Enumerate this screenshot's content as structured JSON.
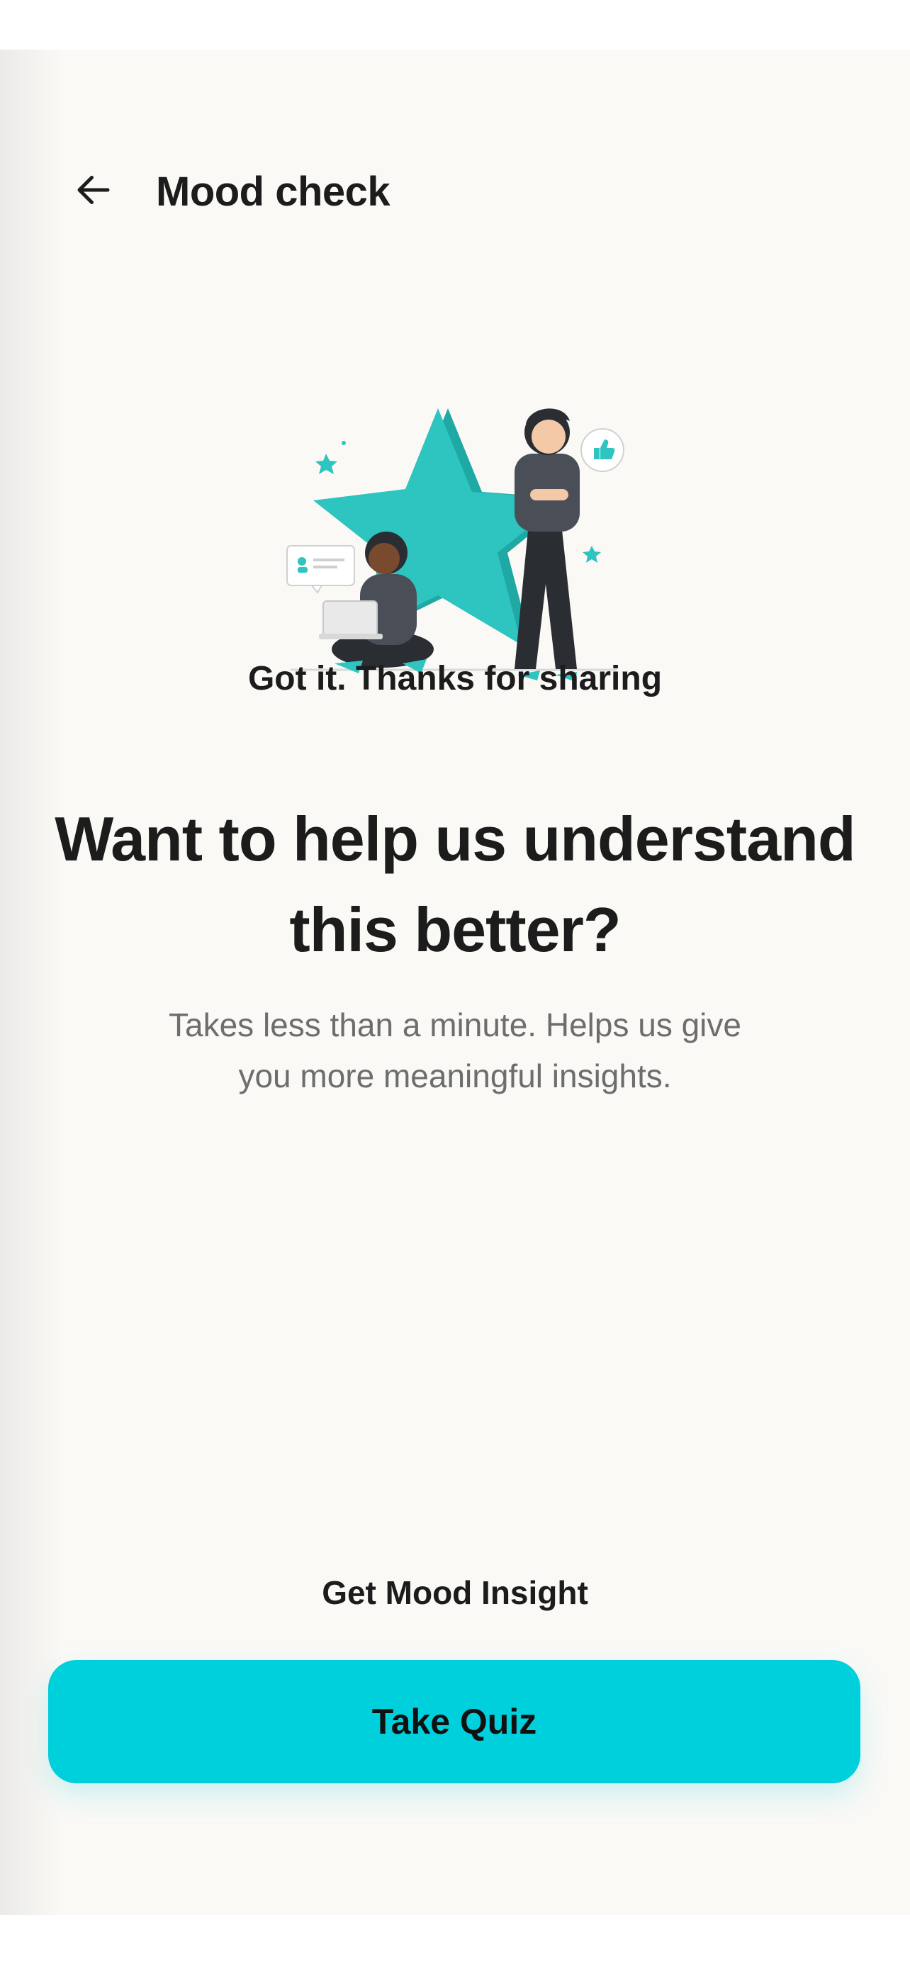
{
  "header": {
    "back_icon": "arrow-left-icon",
    "title": "Mood check"
  },
  "illustration": {
    "name": "two-people-with-star-illustration",
    "accent_color": "#2ec4c0",
    "dark_color": "#2a2d32"
  },
  "content": {
    "acknowledgement": "Got it. Thanks for sharing",
    "headline": "Want to help us understand this better?",
    "subtext": "Takes less than a minute. Helps us give you more meaningful insights."
  },
  "footer": {
    "insight_label": "Get Mood Insight",
    "cta_label": "Take Quiz",
    "cta_color": "#00cfdc"
  }
}
